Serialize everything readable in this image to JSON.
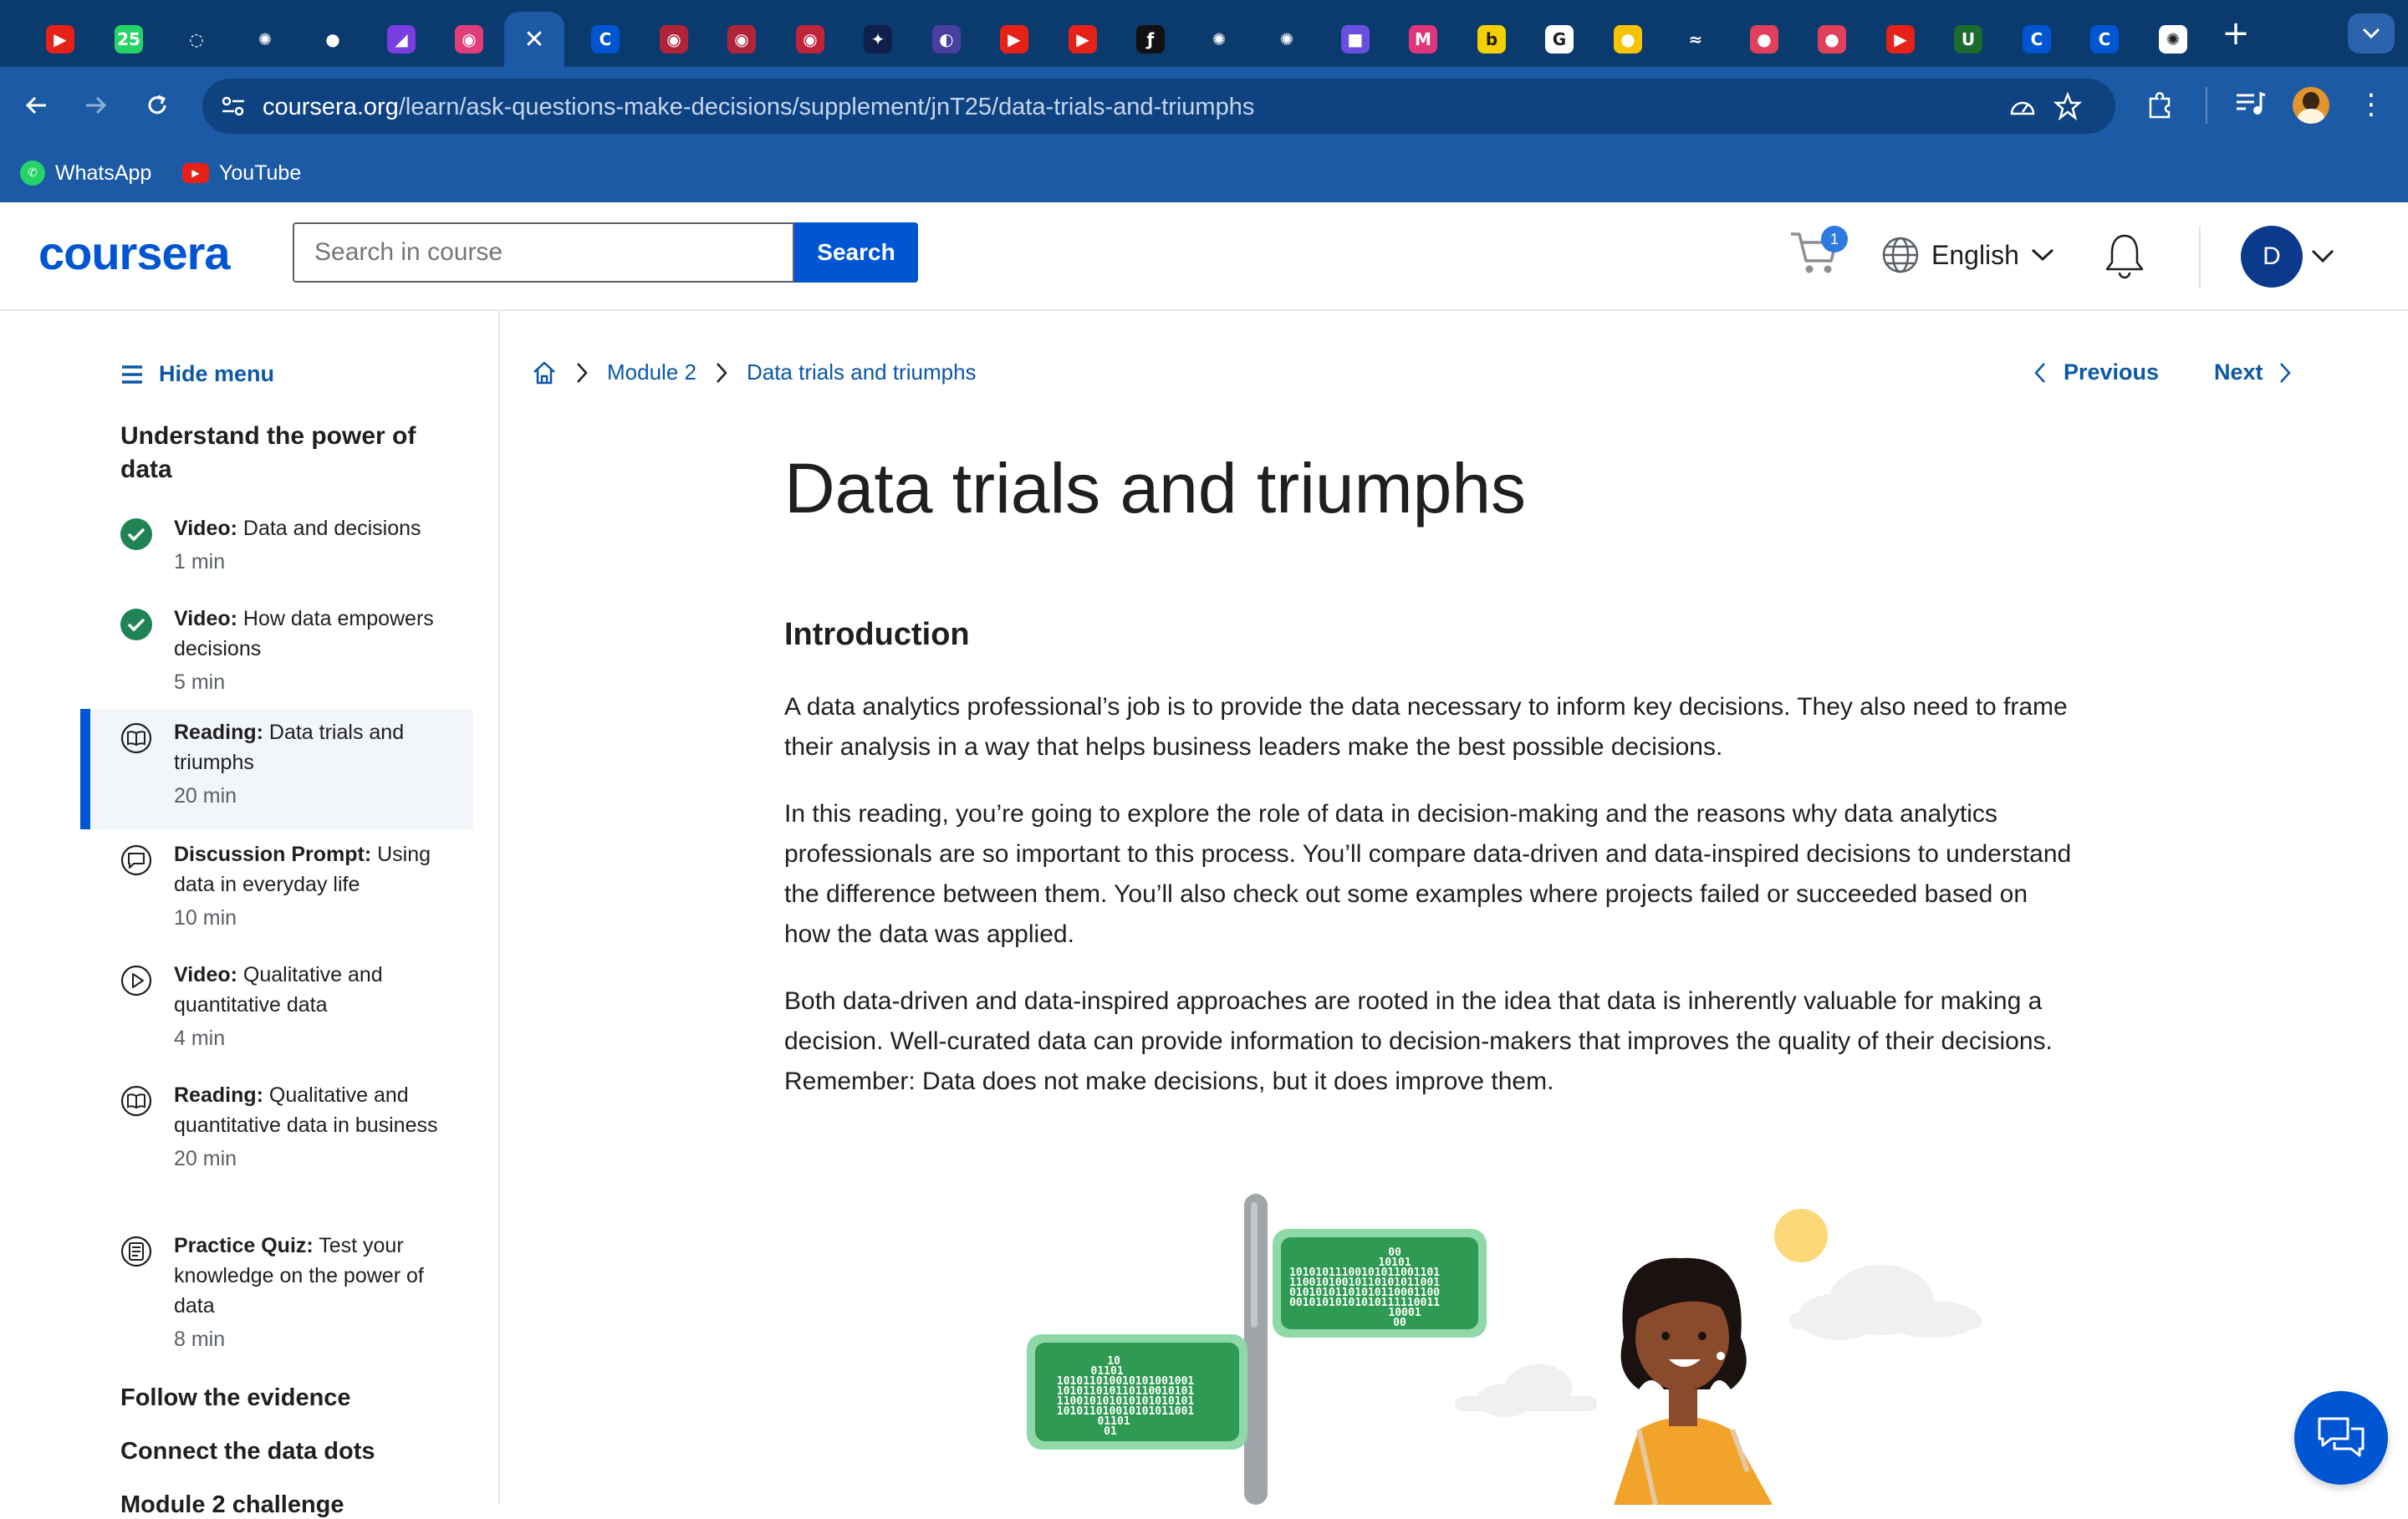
{
  "browser": {
    "tabs": [
      {
        "name": "youtube-tab",
        "icon": "youtube-icon",
        "color": "#e62117",
        "glyph": "▶"
      },
      {
        "name": "whatsapp-tab",
        "icon": "whatsapp-icon",
        "color": "#25d366",
        "glyph": "25"
      },
      {
        "name": "loading-tab",
        "icon": "loading-icon",
        "color": "#0b3a6e",
        "glyph": "◌"
      },
      {
        "name": "openai-tab-1",
        "icon": "openai-icon",
        "color": "#0b3a6e",
        "glyph": "✺"
      },
      {
        "name": "github-tab",
        "icon": "github-icon",
        "color": "#0b3a6e",
        "glyph": "●"
      },
      {
        "name": "app-tab",
        "icon": "app-icon",
        "color": "#7a3ee0",
        "glyph": "◢"
      },
      {
        "name": "record-tab",
        "icon": "record-icon",
        "color": "#e03e7a",
        "glyph": "◉"
      },
      {
        "name": "active-tab",
        "icon": "close-icon",
        "color": "#1d5aa6",
        "glyph": "✕"
      },
      {
        "name": "coursera-tab-1",
        "icon": "coursera-icon",
        "color": "#0056d2",
        "glyph": "C"
      },
      {
        "name": "record-tab-2",
        "icon": "record-icon",
        "color": "#b0243a",
        "glyph": "◉"
      },
      {
        "name": "record-tab-3",
        "icon": "record-icon",
        "color": "#b0243a",
        "glyph": "◉"
      },
      {
        "name": "record-tab-4",
        "icon": "record-icon",
        "color": "#c0243a",
        "glyph": "◉"
      },
      {
        "name": "dark-app-tab",
        "icon": "app-icon",
        "color": "#10204a",
        "glyph": "✦"
      },
      {
        "name": "gemini-tab",
        "icon": "gemini-icon",
        "color": "#4a3ea0",
        "glyph": "◐"
      },
      {
        "name": "youtube-tab-2",
        "icon": "youtube-icon",
        "color": "#e62117",
        "glyph": "▶"
      },
      {
        "name": "youtube-tab-3",
        "icon": "youtube-icon",
        "color": "#e62117",
        "glyph": "▶"
      },
      {
        "name": "font-tab",
        "icon": "font-icon",
        "color": "#111111",
        "glyph": "ƒ"
      },
      {
        "name": "openai-tab-2",
        "icon": "openai-icon",
        "color": "#0b3a6e",
        "glyph": "✺"
      },
      {
        "name": "openai-tab-3",
        "icon": "openai-icon",
        "color": "#0b3a6e",
        "glyph": "✺"
      },
      {
        "name": "video-tab",
        "icon": "video-icon",
        "color": "#6a4ee0",
        "glyph": "■"
      },
      {
        "name": "m-tab",
        "icon": "m-icon",
        "color": "#e0367a",
        "glyph": "M"
      },
      {
        "name": "b-tab",
        "icon": "b-icon",
        "color": "#f5d000",
        "glyph": "b"
      },
      {
        "name": "google-tab",
        "icon": "google-icon",
        "color": "#ffffff",
        "glyph": "G"
      },
      {
        "name": "circle-tab",
        "icon": "circle-icon",
        "color": "#f5c400",
        "glyph": "●"
      },
      {
        "name": "wave-tab",
        "icon": "wave-icon",
        "color": "#0b3a6e",
        "glyph": "≈"
      },
      {
        "name": "ball-tab-1",
        "icon": "ball-icon",
        "color": "#e0405a",
        "glyph": "●"
      },
      {
        "name": "ball-tab-2",
        "icon": "ball-icon",
        "color": "#e0405a",
        "glyph": "●"
      },
      {
        "name": "youtube-tab-4",
        "icon": "youtube-icon",
        "color": "#e62117",
        "glyph": "▶"
      },
      {
        "name": "myunt-tab",
        "icon": "myunt-icon",
        "color": "#1c6b2f",
        "glyph": "U"
      },
      {
        "name": "coursera-tab-2",
        "icon": "coursera-icon",
        "color": "#0056d2",
        "glyph": "C"
      },
      {
        "name": "coursera-tab-3",
        "icon": "coursera-icon",
        "color": "#0056d2",
        "glyph": "C"
      },
      {
        "name": "openai-tab-4",
        "icon": "openai-icon",
        "color": "#ffffff",
        "glyph": "✺"
      }
    ],
    "url_domain": "coursera.org",
    "url_path": "/learn/ask-questions-make-decisions/supplement/jnT25/data-trials-and-triumphs",
    "bookmarks": [
      {
        "label": "WhatsApp",
        "icon": "whatsapp-icon"
      },
      {
        "label": "YouTube",
        "icon": "youtube-icon"
      }
    ]
  },
  "header": {
    "logo": "coursera",
    "search_placeholder": "Search in course",
    "search_button": "Search",
    "cart_count": "1",
    "language": "English",
    "avatar_initial": "D",
    "accent_color": "#0056d2"
  },
  "sidebar": {
    "hide_menu": "Hide menu",
    "module_title": "Understand the power of data",
    "items": [
      {
        "type": "Video:",
        "title": "Data and decisions",
        "duration": "1 min",
        "status": "completed"
      },
      {
        "type": "Video:",
        "title": "How data empowers decisions",
        "duration": "5 min",
        "status": "completed"
      },
      {
        "type": "Reading:",
        "title": "Data trials and triumphs",
        "duration": "20 min",
        "status": "active"
      },
      {
        "type": "Discussion Prompt:",
        "title": "Using data in everyday life",
        "duration": "10 min",
        "status": "todo"
      },
      {
        "type": "Video:",
        "title": "Qualitative and quantitative data",
        "duration": "4 min",
        "status": "todo"
      },
      {
        "type": "Reading:",
        "title": "Qualitative and quantitative data in business",
        "duration": "20 min",
        "status": "todo"
      },
      {
        "type": "Practice Quiz:",
        "title": "Test your knowledge on the power of data",
        "duration": "8 min",
        "status": "todo"
      }
    ],
    "sections": [
      "Follow the evidence",
      "Connect the data dots",
      "Module 2 challenge"
    ]
  },
  "main": {
    "breadcrumb": [
      "Module 2",
      "Data trials and triumphs"
    ],
    "previous": "Previous",
    "next": "Next",
    "title": "Data trials and triumphs",
    "intro_heading": "Introduction",
    "paragraphs": [
      "A data analytics professional’s job is to provide the data necessary to inform key decisions. They also need to frame their analysis in a way that helps business leaders make the best possible decisions.",
      "In this reading, you’re going to explore the role of data in decision-making and the reasons why data analytics professionals are so important to this process. You’ll compare data-driven and data-inspired decisions to understand the difference between them. You’ll also check out some examples where projects failed or succeeded based on how the data was applied.",
      "Both data-driven and data-inspired approaches are rooted in the idea that data is inherently valuable for making a decision. Well-curated data can provide information to  decision-makers that improves the quality of their decisions. Remember: Data does not make decisions, but it does improve them."
    ],
    "sign_right_lines": [
      "00",
      "10101",
      "10101011100101011001101",
      "11001010010110101011001",
      "01010101101010110001100",
      "00101010101010111110011",
      "10001",
      "00"
    ],
    "sign_left_lines": [
      "10",
      "01101",
      "101011010010101001001",
      "101011010110110010101",
      "110010101010101010101",
      "101011010010101011001",
      "01101",
      "01"
    ]
  }
}
